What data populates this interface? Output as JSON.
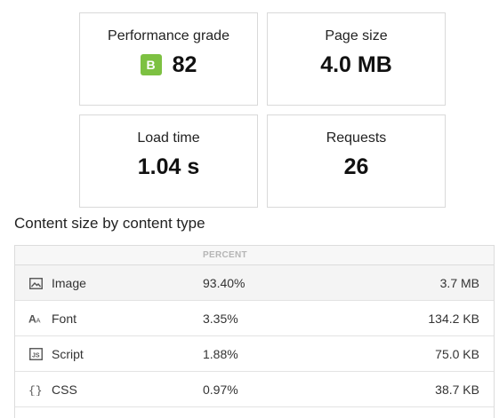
{
  "summary": {
    "performance": {
      "label": "Performance grade",
      "grade": "B",
      "score": "82"
    },
    "page_size": {
      "label": "Page size",
      "value": "4.0 MB"
    },
    "load_time": {
      "label": "Load time",
      "value": "1.04 s"
    },
    "requests": {
      "label": "Requests",
      "value": "26"
    }
  },
  "content_section": {
    "title": "Content size by content type",
    "columns": {
      "percent": "PERCENT"
    },
    "rows": [
      {
        "icon": "image-icon",
        "type": "Image",
        "percent": "93.40%",
        "size": "3.7 MB"
      },
      {
        "icon": "font-icon",
        "type": "Font",
        "percent": "3.35%",
        "size": "134.2 KB"
      },
      {
        "icon": "script-icon",
        "type": "Script",
        "percent": "1.88%",
        "size": "75.0 KB"
      },
      {
        "icon": "css-icon",
        "type": "CSS",
        "percent": "0.97%",
        "size": "38.7 KB"
      }
    ]
  },
  "colors": {
    "grade_badge": "#7dc142",
    "border": "#d9d9d9",
    "row_shade": "#f4f4f4"
  }
}
